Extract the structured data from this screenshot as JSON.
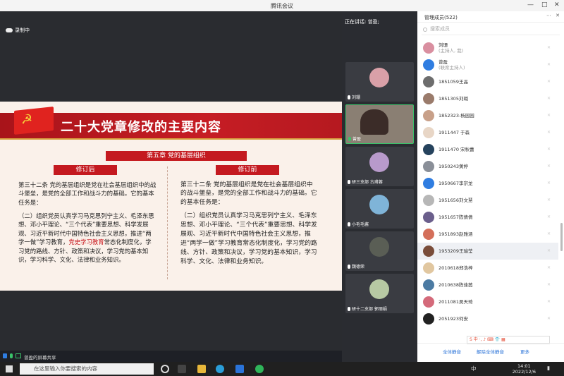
{
  "window": {
    "title": "腾讯会议",
    "controls": [
      "—",
      "□",
      "✕"
    ]
  },
  "stage": {
    "recording_label": "录制中",
    "slide": {
      "title": "二十大党章修改的主要内容",
      "chapter": "第五章 党的基层组织",
      "after_label": "修订后",
      "before_label": "修订前",
      "after_para1": "第三十二条  党的基层组织是党在社会基层组织中的战斗堡垒，是党的全部工作和战斗力的基础。它的基本任务是：",
      "after_para2_a": "（二）组织党员认真学习马克思列宁主义、毛泽东思想、邓小平理论、“三个代表”重要思想、科学发展观、习近平新时代中国特色社会主义思想，推进“两学一做”学习教育，",
      "after_para2_red": "党史学习教育",
      "after_para2_b": "常态化制度化，学习党的路线、方针、政策和决议，学习党的基本知识，学习科学、文化、法律和业务知识。",
      "before_para1": "第三十二条  党的基层组织是党在社会基层组织中的战斗堡垒，是党的全部工作和战斗力的基础。它的基本任务是：",
      "before_para2": "（二）组织党员认真学习马克思列宁主义、毛泽东思想、邓小平理论、“三个代表”重要思想、科学发展观、习近平新时代中国特色社会主义思想，推进“两学一做”学习教育常态化制度化，学习党的路线、方针、政策和决议，学习党的基本知识，学习科学、文化、法律和业务知识。"
    },
    "share_label": "曾盈的屏幕共享"
  },
  "strip": {
    "speaking": "正在讲话: 曾盈;",
    "tiles": [
      {
        "name": "刘珊",
        "color": "#d9a0a8"
      },
      {
        "name": "曾盈",
        "color": "#8a7f73"
      },
      {
        "name": "研三支部 古甫蓉",
        "color": "#b89acb"
      },
      {
        "name": "小毛毛酱",
        "color": "#7fb4d8"
      },
      {
        "name": "魏德荣",
        "color": "#5a5e55"
      },
      {
        "name": "研十二支部 郭丽娟",
        "color": "#b7c9a3"
      }
    ]
  },
  "panel": {
    "header": "管理成员(522)",
    "search_placeholder": "搜索成员",
    "members": [
      {
        "name": "刘珊",
        "sub": "(主持人, 我)",
        "color": "#d98fa0"
      },
      {
        "name": "曾盈",
        "sub": "(联席主持人)",
        "color": "#2f7de1"
      },
      {
        "name": "1851059王晶",
        "sub": "",
        "color": "#6d6d6d"
      },
      {
        "name": "1851305刘璐",
        "sub": "",
        "color": "#9a7b6b"
      },
      {
        "name": "1852323-杨园园",
        "sub": "",
        "color": "#c8a089"
      },
      {
        "name": "1911447 于森",
        "sub": "",
        "color": "#e8d6c6"
      },
      {
        "name": "1911470 宋秋蕾",
        "sub": "",
        "color": "#26435d"
      },
      {
        "name": "1950243黄婷",
        "sub": "",
        "color": "#8a8f98"
      },
      {
        "name": "1950667李宗龙",
        "sub": "",
        "color": "#2f7de1"
      },
      {
        "name": "1951656刘文慧",
        "sub": "",
        "color": "#b7b7b7"
      },
      {
        "name": "1951657陈倩倩",
        "sub": "",
        "color": "#6b5f8c"
      },
      {
        "name": "1951893赵雅涵",
        "sub": "",
        "color": "#d46f5a"
      },
      {
        "name": "1953209王瑜莹",
        "sub": "",
        "color": "#7a4d3a"
      },
      {
        "name": "2010618郑浩梓",
        "sub": "",
        "color": "#e1c7a0"
      },
      {
        "name": "2010638陈佳茜",
        "sub": "",
        "color": "#4c7ba3"
      },
      {
        "name": "2011081吴天琦",
        "sub": "",
        "color": "#d46a7a"
      },
      {
        "name": "2051923何安",
        "sub": "",
        "color": "#222222"
      }
    ],
    "footer": {
      "mute_all": "全体静音",
      "unmute_all": "解除全体静音",
      "more": "更多"
    },
    "ime": "S 中 ·, ♪ ⌨ 👕 ▦"
  },
  "taskbar": {
    "search_placeholder": "在这里输入你要搜索的内容",
    "time": "14:01",
    "date": "2022/12/6",
    "lang": "中"
  }
}
